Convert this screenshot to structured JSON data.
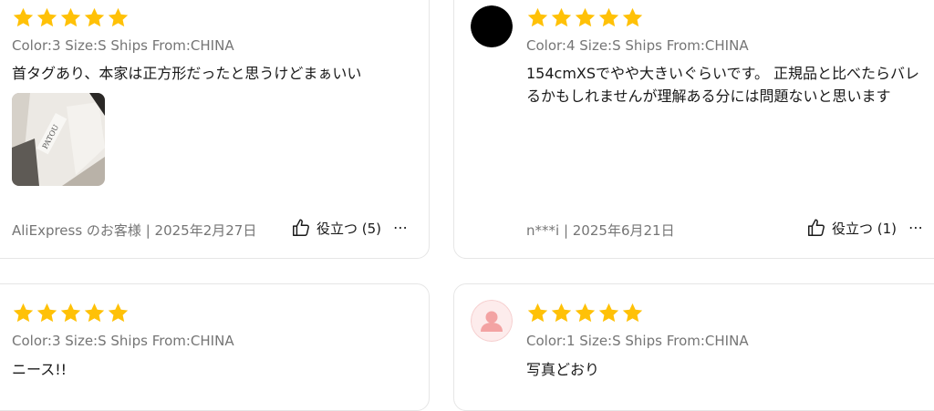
{
  "colors": {
    "star": "#FFC107",
    "text": "#191919",
    "muted": "#757575",
    "border": "#e6e6e6"
  },
  "reviews": [
    {
      "rating": 5,
      "sku": "Color:3 Size:S Ships From:CHINA",
      "text": "首タグあり、本家は正方形だったと思うけどまぁいい",
      "photo_icon": "review-photo",
      "author_date": "AliExpress のお客様 | 2025年2月27日",
      "helpful_label": "役立つ (5)",
      "more_label": "⋯"
    },
    {
      "rating": 5,
      "avatar_icon": "black-circle-avatar",
      "sku": "Color:4 Size:S Ships From:CHINA",
      "text": "154cmXSでやや大きいぐらいです。 正規品と比べたらバレるかもしれませんが理解ある分には問題ないと思います",
      "author_date": "n***i | 2025年6月21日",
      "helpful_label": "役立つ (1)",
      "more_label": "⋯"
    },
    {
      "rating": 5,
      "sku": "Color:3 Size:S Ships From:CHINA",
      "text": "ニース!!"
    },
    {
      "rating": 5,
      "avatar_icon": "default-user-avatar",
      "sku": "Color:1 Size:S Ships From:CHINA",
      "text": "写真どおり"
    }
  ]
}
